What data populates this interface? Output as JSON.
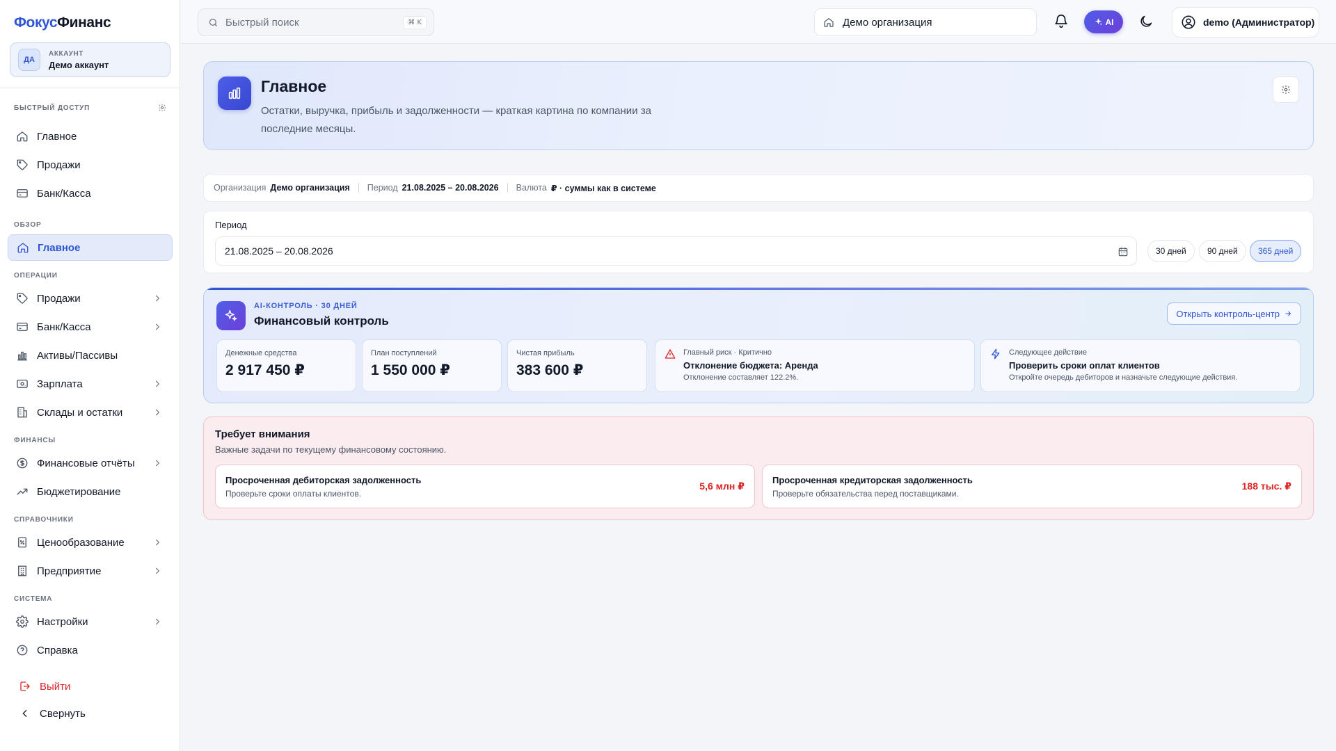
{
  "app": {
    "logo_part1": "Фокус",
    "logo_part2": "Финанс"
  },
  "account": {
    "initials": "ДА",
    "label": "АККАУНТ",
    "name": "Демо аккаунт"
  },
  "sidebar": {
    "sections": {
      "quick": "БЫСТРЫЙ ДОСТУП",
      "overview": "ОБЗОР",
      "operations": "ОПЕРАЦИИ",
      "finance": "ФИНАНСЫ",
      "references": "СПРАВОЧНИКИ",
      "system": "СИСТЕМА"
    },
    "quick": [
      "Главное",
      "Продажи",
      "Банк/Касса"
    ],
    "overview": [
      "Главное"
    ],
    "operations": [
      "Продажи",
      "Банк/Касса",
      "Активы/Пассивы",
      "Зарплата",
      "Склады и остатки"
    ],
    "finance": [
      "Финансовые отчёты",
      "Бюджетирование"
    ],
    "references": [
      "Ценообразование",
      "Предприятие"
    ],
    "system": [
      "Настройки",
      "Справка"
    ],
    "logout": "Выйти",
    "collapse": "Свернуть"
  },
  "topbar": {
    "search_placeholder": "Быстрый поиск",
    "search_shortcut": "⌘ K",
    "organization": "Демо организация",
    "ai_label": "AI",
    "user": "demo (Администратор)"
  },
  "hero": {
    "title": "Главное",
    "subtitle": "Остатки, выручка, прибыль и задолженности — краткая картина по компании за последние месяцы."
  },
  "context": {
    "org_key": "Организация",
    "org_value": "Демо организация",
    "period_key": "Период",
    "period_value": "21.08.2025 – 20.08.2026",
    "currency_key": "Валюта",
    "currency_value": "₽ · суммы как в системе"
  },
  "period": {
    "label": "Период",
    "value": "21.08.2025 – 20.08.2026",
    "chips": [
      "30 дней",
      "90 дней",
      "365 дней"
    ],
    "active_chip": "365 дней"
  },
  "ai_control": {
    "kicker": "AI-КОНТРОЛЬ · 30 ДНЕЙ",
    "title": "Финансовый контроль",
    "open_button": "Открыть контроль-центр",
    "metrics": [
      {
        "label": "Денежные средства",
        "value": "2 917 450 ₽"
      },
      {
        "label": "План поступлений",
        "value": "1 550 000 ₽"
      },
      {
        "label": "Чистая прибыль",
        "value": "383 600 ₽"
      }
    ],
    "risk": {
      "kicker": "Главный риск · Критично",
      "title": "Отклонение бюджета: Аренда",
      "desc": "Отклонение составляет 122.2%."
    },
    "next_action": {
      "kicker": "Следующее действие",
      "title": "Проверить сроки оплат клиентов",
      "desc": "Откройте очередь дебиторов и назначьте следующие действия."
    }
  },
  "attention": {
    "title": "Требует внимания",
    "subtitle": "Важные задачи по текущему финансовому состоянию.",
    "items": [
      {
        "title": "Просроченная дебиторская задолженность",
        "desc": "Проверьте сроки оплаты клиентов.",
        "value": "5,6 млн ₽"
      },
      {
        "title": "Просроченная кредиторская задолженность",
        "desc": "Проверьте обязательства перед поставщиками.",
        "value": "188 тыс. ₽"
      }
    ]
  },
  "colors": {
    "accent": "#2f55d4",
    "danger": "#dc2626",
    "ai_gradient_start": "#4f5ee8",
    "ai_gradient_end": "#6d3fd8"
  }
}
